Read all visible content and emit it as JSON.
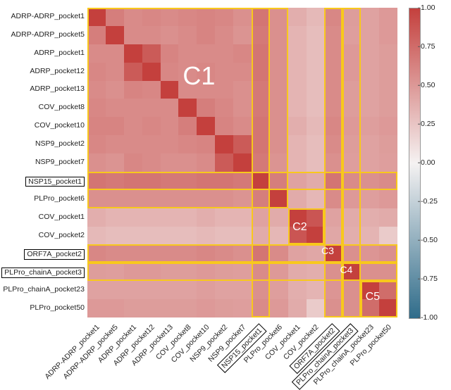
{
  "chart_data": {
    "type": "heatmap",
    "labels": [
      "ADRP-ADRP_pocket1",
      "ADRP-ADRP_pocket5",
      "ADRP_pocket1",
      "ADRP_pocket12",
      "ADRP_pocket13",
      "COV_pocket8",
      "COV_pocket10",
      "NSP9_pocket2",
      "NSP9_pocket7",
      "NSP15_pocket1",
      "PLPro_pocket6",
      "COV_pocket1",
      "COV_pocket2",
      "ORF7A_pocket2",
      "PLPro_chainA_pocket3",
      "PLPro_chainA_pocket23",
      "PLPro_pocket50"
    ],
    "boxed_labels": [
      "NSP15_pocket1",
      "ORF7A_pocket2",
      "PLPro_chainA_pocket3"
    ],
    "colorbar": {
      "min": -1.0,
      "max": 1.0,
      "ticks": [
        -1.0,
        -0.75,
        -0.5,
        -0.25,
        0.0,
        0.25,
        0.5,
        0.75,
        1.0
      ]
    },
    "clusters": [
      {
        "name": "C1",
        "label": "C1",
        "row_start": 0,
        "row_end": 11,
        "col_start": 0,
        "col_end": 11,
        "label_font": 36,
        "label_pos": [
          0.36,
          0.22
        ]
      },
      {
        "name": "C2",
        "label": "C2",
        "row_start": 11,
        "row_end": 13,
        "col_start": 11,
        "col_end": 13,
        "label_font": 16,
        "label_pos": [
          0.685,
          0.71
        ]
      },
      {
        "name": "C3",
        "label": "C3",
        "row_start": 13,
        "row_end": 14,
        "col_start": 13,
        "col_end": 14,
        "label_font": 14,
        "label_pos": [
          0.775,
          0.785
        ]
      },
      {
        "name": "C4",
        "label": "C4",
        "row_start": 14,
        "row_end": 15,
        "col_start": 14,
        "col_end": 15,
        "label_font": 14,
        "label_pos": [
          0.835,
          0.845
        ]
      },
      {
        "name": "C5",
        "label": "C5",
        "row_start": 15,
        "row_end": 17,
        "col_start": 15,
        "col_end": 17,
        "label_font": 16,
        "label_pos": [
          0.92,
          0.935
        ]
      }
    ],
    "highlight_rows": [
      9,
      13,
      14
    ],
    "dashed_box": {
      "row_start": 0,
      "row_end": 11,
      "col_start": 0,
      "col_end": 11
    },
    "matrix": [
      [
        1.0,
        0.65,
        0.58,
        0.6,
        0.58,
        0.6,
        0.62,
        0.6,
        0.55,
        0.7,
        0.55,
        0.38,
        0.32,
        0.6,
        0.48,
        0.45,
        0.5
      ],
      [
        0.65,
        1.0,
        0.58,
        0.58,
        0.55,
        0.58,
        0.62,
        0.58,
        0.53,
        0.68,
        0.55,
        0.35,
        0.3,
        0.58,
        0.47,
        0.45,
        0.5
      ],
      [
        0.58,
        0.58,
        1.0,
        0.85,
        0.62,
        0.58,
        0.58,
        0.58,
        0.6,
        0.7,
        0.55,
        0.35,
        0.3,
        0.58,
        0.5,
        0.45,
        0.48
      ],
      [
        0.6,
        0.58,
        0.85,
        1.0,
        0.6,
        0.58,
        0.6,
        0.58,
        0.58,
        0.7,
        0.55,
        0.35,
        0.3,
        0.58,
        0.5,
        0.45,
        0.48
      ],
      [
        0.58,
        0.55,
        0.62,
        0.6,
        1.0,
        0.58,
        0.58,
        0.58,
        0.55,
        0.68,
        0.55,
        0.35,
        0.3,
        0.58,
        0.48,
        0.45,
        0.48
      ],
      [
        0.6,
        0.58,
        0.58,
        0.58,
        0.58,
        1.0,
        0.65,
        0.6,
        0.55,
        0.68,
        0.55,
        0.35,
        0.3,
        0.58,
        0.48,
        0.45,
        0.48
      ],
      [
        0.62,
        0.62,
        0.58,
        0.6,
        0.58,
        0.65,
        1.0,
        0.62,
        0.58,
        0.7,
        0.55,
        0.38,
        0.32,
        0.6,
        0.5,
        0.47,
        0.5
      ],
      [
        0.6,
        0.58,
        0.58,
        0.58,
        0.58,
        0.6,
        0.62,
        1.0,
        0.85,
        0.7,
        0.55,
        0.35,
        0.3,
        0.58,
        0.48,
        0.45,
        0.48
      ],
      [
        0.55,
        0.53,
        0.6,
        0.58,
        0.55,
        0.55,
        0.58,
        0.85,
        1.0,
        0.68,
        0.53,
        0.35,
        0.3,
        0.55,
        0.47,
        0.45,
        0.47
      ],
      [
        0.7,
        0.68,
        0.7,
        0.7,
        0.68,
        0.68,
        0.7,
        0.7,
        0.68,
        1.0,
        0.65,
        0.45,
        0.4,
        0.7,
        0.58,
        0.55,
        0.58
      ],
      [
        0.55,
        0.55,
        0.55,
        0.55,
        0.55,
        0.55,
        0.55,
        0.55,
        0.53,
        0.65,
        1.0,
        0.4,
        0.33,
        0.58,
        0.5,
        0.47,
        0.5
      ],
      [
        0.38,
        0.35,
        0.35,
        0.35,
        0.35,
        0.35,
        0.38,
        0.35,
        0.35,
        0.45,
        0.4,
        1.0,
        0.88,
        0.45,
        0.4,
        0.38,
        0.4
      ],
      [
        0.32,
        0.3,
        0.3,
        0.3,
        0.3,
        0.3,
        0.32,
        0.3,
        0.3,
        0.4,
        0.33,
        0.88,
        1.0,
        0.42,
        0.38,
        0.35,
        0.22
      ],
      [
        0.6,
        0.58,
        0.58,
        0.58,
        0.58,
        0.58,
        0.6,
        0.58,
        0.55,
        0.7,
        0.58,
        0.45,
        0.42,
        1.0,
        0.55,
        0.52,
        0.55
      ],
      [
        0.48,
        0.47,
        0.5,
        0.5,
        0.48,
        0.48,
        0.5,
        0.48,
        0.47,
        0.58,
        0.5,
        0.4,
        0.38,
        0.55,
        1.0,
        0.55,
        0.55
      ],
      [
        0.45,
        0.45,
        0.45,
        0.45,
        0.45,
        0.45,
        0.47,
        0.45,
        0.45,
        0.55,
        0.47,
        0.38,
        0.35,
        0.52,
        0.55,
        1.0,
        0.75
      ],
      [
        0.5,
        0.5,
        0.48,
        0.48,
        0.48,
        0.48,
        0.5,
        0.48,
        0.47,
        0.58,
        0.5,
        0.4,
        0.22,
        0.55,
        0.55,
        0.75,
        1.0
      ]
    ]
  }
}
